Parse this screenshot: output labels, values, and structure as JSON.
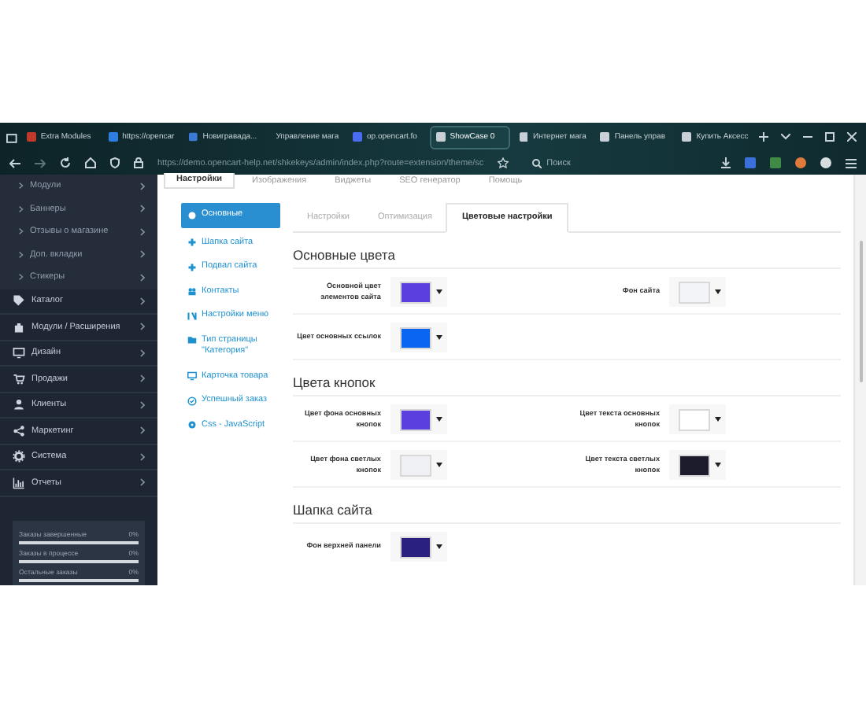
{
  "browser": {
    "tabs": [
      {
        "label": "Extra Modules",
        "selected": false
      },
      {
        "label": "https://opencar",
        "selected": false
      },
      {
        "label": "Новигравада...",
        "selected": false
      },
      {
        "label": "Управление мага",
        "selected": false
      },
      {
        "label": "op.opencart.fo",
        "selected": false
      },
      {
        "label": "ShowCase 0",
        "selected": true
      },
      {
        "label": "Интернет мага",
        "selected": false
      },
      {
        "label": "Панель управ",
        "selected": false
      },
      {
        "label": "Купить Аксесс",
        "selected": false
      }
    ],
    "url": "https://demo.opencart-help.net/shkekeys/admin/index.php?route=extension/theme/sc",
    "search": {
      "placeholder": "Поиск"
    }
  },
  "sidebar": {
    "submenu": [
      "Модули",
      "Баннеры",
      "Отзывы о магазине",
      "Доп. вкладки",
      "Стикеры"
    ],
    "items": [
      "Каталог",
      "Модули / Расширения",
      "Дизайн",
      "Продажи",
      "Клиенты",
      "Маркетинг",
      "Система",
      "Отчеты"
    ],
    "stats": [
      {
        "label": "Заказы завершенные",
        "value": "0%",
        "level": 0
      },
      {
        "label": "Заказы в процессе",
        "value": "0%",
        "level": 0
      },
      {
        "label": "Остальные заказы",
        "value": "0%",
        "level": 0
      }
    ]
  },
  "page_tabs": [
    {
      "label": "Настройки",
      "selected": true
    },
    {
      "label": "Изображения",
      "selected": false
    },
    {
      "label": "Виджеты",
      "selected": false
    },
    {
      "label": "SEO генератор",
      "selected": false
    },
    {
      "label": "Помощь",
      "selected": false
    }
  ],
  "settings_nav": [
    {
      "label": "Основные",
      "selected": true
    },
    {
      "label": "Шапка сайта",
      "selected": false
    },
    {
      "label": "Подвал сайта",
      "selected": false
    },
    {
      "label": "Контакты",
      "selected": false
    },
    {
      "label": "Настройки меню",
      "selected": false
    },
    {
      "label": "Тип страницы \"Категория\"",
      "selected": false
    },
    {
      "label": "Карточка товара",
      "selected": false
    },
    {
      "label": "Успешный заказ",
      "selected": false
    },
    {
      "label": "Css - JavaScript",
      "selected": false
    }
  ],
  "sub_tabs": [
    {
      "label": "Настройки",
      "selected": false
    },
    {
      "label": "Оптимизация",
      "selected": false
    },
    {
      "label": "Цветовые настройки",
      "selected": true
    }
  ],
  "sections": [
    {
      "title": "Основные цвета",
      "rows": [
        [
          {
            "label": "Основной цвет элементов сайта",
            "color": "#5b3fdf"
          },
          {
            "label": "Фон сайта",
            "color": "#f2f4f7"
          }
        ],
        [
          {
            "label": "Цвет основных ссылок",
            "color": "#0a66f0"
          }
        ]
      ]
    },
    {
      "title": "Цвета кнопок",
      "rows": [
        [
          {
            "label": "Цвет фона основных кнопок",
            "color": "#5b3fdf"
          },
          {
            "label": "Цвет текста основных кнопок",
            "color": "#ffffff"
          }
        ],
        [
          {
            "label": "Цвет фона светлых кнопок",
            "color": "#eef0f4"
          },
          {
            "label": "Цвет текста светлых кнопок",
            "color": "#1c1c2c"
          }
        ]
      ]
    },
    {
      "title": "Шапка сайта",
      "rows": [
        [
          {
            "label": "Фон верхней панели",
            "color": "#2a2080"
          }
        ]
      ]
    }
  ]
}
